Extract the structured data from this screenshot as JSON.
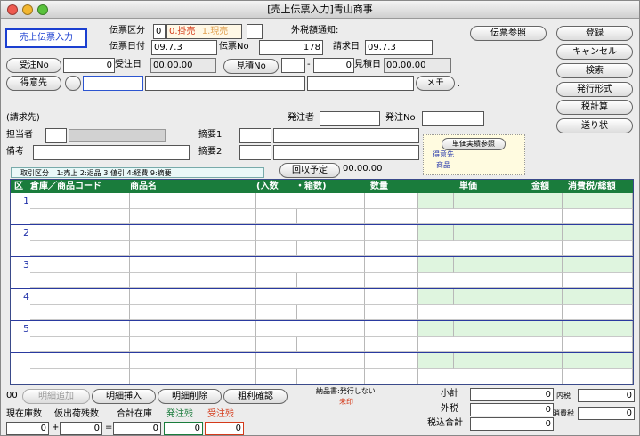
{
  "window": {
    "title": "[売上伝票入力]青山商事"
  },
  "header": {
    "screen_label": "売上伝票入力",
    "slip_type_label": "伝票区分",
    "slip_type_value": "0",
    "slip_type_opt0": "0.掛売",
    "slip_type_opt1": "1.現売",
    "tax_notice_label": "外税額通知:",
    "slip_date_label": "伝票日付",
    "slip_date": "09.7.3",
    "slip_no_label": "伝票No",
    "slip_no": "178",
    "bill_date_label": "請求日",
    "bill_date": "09.7.3",
    "order_no_btn": "受注No",
    "order_no": "0",
    "order_date_label": "受注日",
    "order_date": "00.00.00",
    "estimate_no_btn": "見積No",
    "estimate_dash": "-",
    "estimate_no": "0",
    "estimate_date_label": "見積日",
    "estimate_date": "00.00.00",
    "customer_btn": "得意先",
    "memo_btn": "メモ",
    "memo_dot": ".",
    "bill_to_label": "(請求先)",
    "orderer_label": "発注者",
    "order_no2_label": "発注No",
    "staff_label": "担当者",
    "summary1_label": "摘要1",
    "note_label": "備考",
    "summary2_label": "摘要2",
    "ref_btn": "単価実績参照",
    "ref_opt1": "得意先",
    "ref_opt2": "商品",
    "type_box_label": "取引区分",
    "type_box_values": "1:売上  2:返品  3:値引  4:経費  9:摘要",
    "collect_btn": "回収予定",
    "collect_date": "00.00.00",
    "slip_ref_btn": "伝票参照"
  },
  "side_buttons": [
    "登録",
    "キャンセル",
    "検索",
    "発行形式",
    "税計算",
    "送り状"
  ],
  "grid": {
    "headers": {
      "kubun": "区",
      "code": "倉庫／商品コード",
      "name": "商品名",
      "pack": "(入数",
      "boxes": "・箱数)",
      "qty": "数量",
      "price": "単価",
      "amount": "金額",
      "tax": "消費税/総額"
    },
    "row_numbers": [
      "1",
      "2",
      "3",
      "4",
      "5",
      ""
    ]
  },
  "footer": {
    "line_count": "00",
    "add_btn": "明細追加",
    "insert_btn": "明細挿入",
    "delete_btn": "明細削除",
    "margin_btn": "粗利確認",
    "delivery_label": "納品書:発行しない",
    "issued_label": "未印",
    "subtotal_label": "小計",
    "subtotal": "0",
    "outtax_label": "外税",
    "outtax": "0",
    "total_label": "税込合計",
    "total": "0",
    "intax_label": "内税",
    "intax": "0",
    "ctax_label": "消費税",
    "ctax": "0",
    "stock_labels": {
      "current": "現在庫数",
      "tentative": "仮出荷残数",
      "total": "合計在庫",
      "ship": "発注残",
      "recv": "受注残"
    },
    "stock_values": {
      "current": "0",
      "plus": "+",
      "tentative": "0",
      "eq": "=",
      "total": "0",
      "ship": "0",
      "recv": "0"
    }
  },
  "colors": {
    "header_green": "#1a7c3c",
    "row_divider": "#2a3aa0",
    "accent_red": "#d43a1a",
    "accent_orange": "#e08a2a"
  }
}
